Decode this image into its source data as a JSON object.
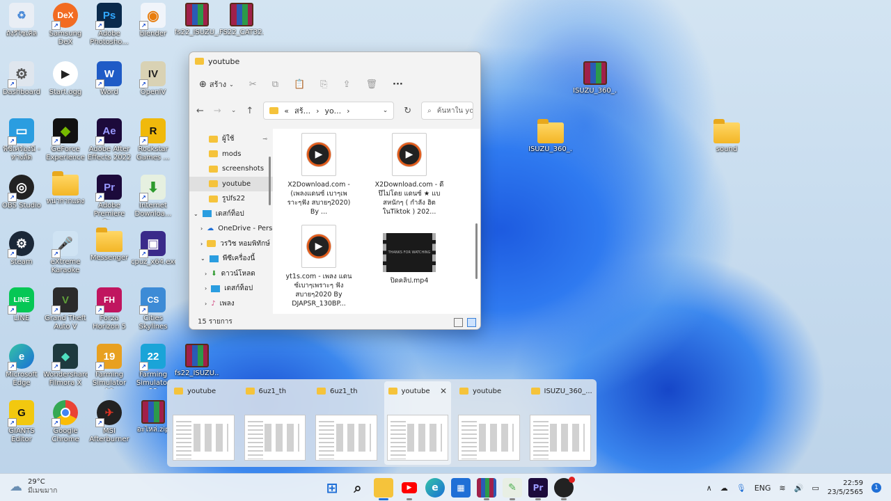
{
  "desktop": {
    "icons": [
      {
        "label": "ถังรีไซเคิล"
      },
      {
        "label": "Samsung DeX",
        "glyph": "DeX",
        "color": "#f26b22"
      },
      {
        "label": "Adobe Photosho...",
        "glyph": "Ps",
        "color": "#0a2a4c"
      },
      {
        "label": "blender"
      },
      {
        "label": "fs22_ISUZU_..."
      },
      {
        "label": "FS22_CAT32..."
      },
      {
        "label": "Dashboard"
      },
      {
        "label": "Start.ogg"
      },
      {
        "label": "Word",
        "glyph": "W",
        "color": "#1f5bc6"
      },
      {
        "label": "OpenIV",
        "glyph": "IV",
        "color": "#d9d2b4"
      },
      {
        "label": "พีซีเครื่องนี้ - ทางลัด"
      },
      {
        "label": "GeForce Experience"
      },
      {
        "label": "Adobe After Effects 2022",
        "glyph": "Ae",
        "color": "#1c0a3b"
      },
      {
        "label": "Rockstar Games ...",
        "glyph": "R",
        "color": "#f0b90b"
      },
      {
        "label": "OBS Studio"
      },
      {
        "label": "หน่ากากแดง"
      },
      {
        "label": "Adobe Premiere Pr...",
        "glyph": "Pr",
        "color": "#1c0a3b"
      },
      {
        "label": "Internet Downloa..."
      },
      {
        "label": "steam"
      },
      {
        "label": "eXtreme Karaoke"
      },
      {
        "label": "Messenger"
      },
      {
        "label": "cpuz_x64.exe"
      },
      {
        "label": "LINE",
        "glyph": "LINE",
        "color": "#06c755"
      },
      {
        "label": "Grand Theft Auto V",
        "glyph": "V",
        "color": "#2b2b2b"
      },
      {
        "label": "Forza Horizon 5",
        "glyph": "FH",
        "color": "#c0155f"
      },
      {
        "label": "Cities Skylines",
        "glyph": "CS",
        "color": "#3d8bd6"
      },
      {
        "label": "Microsoft Edge"
      },
      {
        "label": "Wondershare Filmora X"
      },
      {
        "label": "Farming Simulator 19",
        "glyph": "19",
        "color": "#e8a020"
      },
      {
        "label": "Farming Simulator 22",
        "glyph": "22",
        "color": "#1aa4d8"
      },
      {
        "label": "fs22_ISUZU..."
      },
      {
        "label": "GIANTS Editor"
      },
      {
        "label": "Google Chrome"
      },
      {
        "label": "MSI Afterburner"
      },
      {
        "label": "อะไหล่.zip"
      }
    ],
    "right_icons": [
      {
        "label": "ISUZU_360_..."
      },
      {
        "label": "ISUZU_360_..."
      },
      {
        "label": "sound"
      }
    ]
  },
  "explorer": {
    "title": "youtube",
    "toolbar": {
      "new_label": "สร้าง",
      "more_label": "···"
    },
    "address": {
      "path_prefix": "«",
      "seg1": "สร้...",
      "seg2": "yo...",
      "sep": "›"
    },
    "search_placeholder": "ค้นหาใน youtube",
    "nav": [
      {
        "label": "ผู้ใช้",
        "pinned": "📌"
      },
      {
        "label": "mods"
      },
      {
        "label": "screenshots"
      },
      {
        "label": "youtube",
        "selected": true
      },
      {
        "label": "รูปfs22"
      },
      {
        "label": "เดสก์ท็อป"
      },
      {
        "label": "OneDrive - Perso"
      },
      {
        "label": "วรวิช หอมพิทักษ์"
      },
      {
        "label": "พีซีเครื่องนี้"
      },
      {
        "label": "ดาวน์โหลด"
      },
      {
        "label": "เดสก์ท็อป"
      },
      {
        "label": "เพลง"
      }
    ],
    "files": [
      {
        "name": "X2Download.com - (เพลงแดนซ์ เบาๆเพราะๆฟัง สบายๆ2020) By ..."
      },
      {
        "name": "X2Download.com - ดีป๊ไม่โดย แดนซ์ ★ แบสหนักๆ ( กำลัง ฮิตในTiktok ) 202..."
      },
      {
        "name": "yt1s.com - เพลง แดนซ์เบาๆเพราะๆ ฟังสบายๆ2020 By DJAPSR_130BP..."
      },
      {
        "name": "ปิดคลิป.mp4",
        "thumb_text": "THANKS FOR WATCHING"
      }
    ],
    "status": "15 รายการ"
  },
  "switcher": {
    "windows": [
      {
        "title": "youtube"
      },
      {
        "title": "6uz1_th"
      },
      {
        "title": "6uz1_th"
      },
      {
        "title": "youtube",
        "active": true
      },
      {
        "title": "youtube"
      },
      {
        "title": "ISUZU_360_..."
      }
    ],
    "close_label": "✕"
  },
  "taskbar": {
    "weather_temp": "29°C",
    "weather_desc": "มีเมฆมาก",
    "lang": "ENG",
    "time": "22:59",
    "date": "23/5/2565",
    "notif_count": "1",
    "apps": [
      {
        "name": "start-button",
        "glyph": "⊞",
        "color": "#1f6fd6"
      },
      {
        "name": "search",
        "glyph": "⌕",
        "color": "#222"
      },
      {
        "name": "file-explorer",
        "glyph": "▬",
        "color": "#f5c33b"
      },
      {
        "name": "youtube",
        "glyph": "▶",
        "color": "#ff0000"
      },
      {
        "name": "edge",
        "glyph": "e",
        "color": "#1a8ad8"
      },
      {
        "name": "store",
        "glyph": "▦",
        "color": "#1f6fd6"
      },
      {
        "name": "winrar",
        "glyph": "▥",
        "color": "#a0204a"
      },
      {
        "name": "notepad",
        "glyph": "✎",
        "color": "#4caf50"
      },
      {
        "name": "premiere",
        "glyph": "Pr",
        "color": "#1c0a3b"
      },
      {
        "name": "obs",
        "glyph": "●",
        "color": "#222"
      }
    ]
  }
}
